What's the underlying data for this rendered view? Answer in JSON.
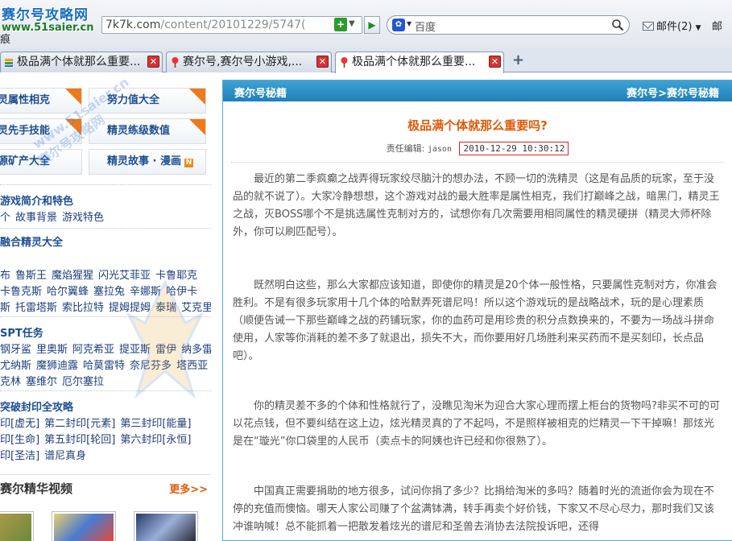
{
  "browser": {
    "logo_line1": "赛尔号攻略网",
    "logo_line2": "www.51saier.cn",
    "address_main": "7k7k.com",
    "address_rest": "/content/20101229/5747(",
    "search_placeholder": "百度",
    "mail_label": "邮件(2)",
    "extra_menu": "邮",
    "trace_label": "痕",
    "new_tab": "+"
  },
  "tabs": [
    {
      "label": "极品满个体就那么重要..."
    },
    {
      "label": "赛尔号,赛尔号小游戏,..."
    },
    {
      "label": "极品满个体就那么重要..."
    }
  ],
  "sidebar": {
    "features": [
      {
        "label": "灵属性相克"
      },
      {
        "label": "努力值大全"
      },
      {
        "label": "灵先手技能"
      },
      {
        "label": "精灵练级数值"
      },
      {
        "label": "源矿产大全"
      },
      {
        "label": "精灵故事 · 漫画",
        "badge": "N"
      }
    ],
    "sections": [
      {
        "title": "游戏简介和特色",
        "rows": [
          [
            "个",
            "故事背景",
            "游戏特色"
          ]
        ]
      },
      {
        "title": "融合精灵大全",
        "rows": [
          [
            "布",
            "鲁斯王",
            "魔焰猩猩",
            "闪光艾菲亚",
            "卡鲁耶克"
          ],
          [
            "卡鲁克斯",
            "哈尔翼蜂",
            "塞拉兔",
            "辛娜斯",
            "哈伊卡"
          ],
          [
            "斯",
            "托雷塔斯",
            "索比拉特",
            "提姆提姆",
            "泰瑞",
            "艾克里桑"
          ]
        ]
      },
      {
        "title": "SPT任务",
        "rows": [
          [
            "钢牙鲨",
            "里奥斯",
            "阿克希亚",
            "提亚斯",
            "雷伊",
            "纳多雷"
          ],
          [
            "尤纳斯",
            "魔狮迪露",
            "哈莫雷特",
            "奈尼芬多",
            "塔西亚"
          ],
          [
            "克林",
            "塞维尔",
            "厄尔塞拉"
          ]
        ]
      },
      {
        "title": "突破封印全攻略",
        "rows": [
          [
            "印[虚无]",
            "第二封印[元素]",
            "第三封印[能量]"
          ],
          [
            "印[生命]",
            "第五封印[轮回]",
            "第六封印[永恒]"
          ],
          [
            "印[圣洁]",
            "谱尼真身"
          ]
        ]
      }
    ],
    "video_title": "赛尔精华视频",
    "video_more": "更多>>",
    "watermark_text": "www.51saier.cn",
    "watermark_text2": "赛尔号攻略网"
  },
  "panel": {
    "header_title": "赛尔号秘籍",
    "breadcrumb": "赛尔号>赛尔号秘籍",
    "article_title": "极品满个体就那么重要吗?",
    "editor_label": "责任编辑:",
    "editor_name": "jason",
    "date": "2010-12-29 10:30:12",
    "paragraphs": [
      "最近的第二季疯癫之战弄得玩家绞尽脑汁的想办法，不顾一切的洗精灵（这是有品质的玩家，至于没品的就不说了）。大家冷静想想，这个游戏对战的最大胜率是属性相克，我们打巅峰之战，暗黑门，精灵王之战，灭BOSS哪个不是挑选属性克制对方的，试想你有几次需要用相同属性的精灵硬拼（精灵大师杯除外，你可以刷匹配号）。",
      "既然明白这些，那么大家都应该知道，即使你的精灵是20个体一般性格，只要属性克制对方，你准会胜利。不是有很多玩家用十几个体的哈默弄死谱尼吗！所以这个游戏玩的是战略战术，玩的是心理素质（顺便告诫一下那些巅峰之战的药铺玩家，你的血药可是用珍贵的积分点数换来的，不要为一场战斗拼命使用，人家等你消耗的差不多了就退出，损失不大，而你要用好几场胜利来买药而不是买刻印，长点品吧）。",
      "你的精灵差不多的个体和性格就行了，没瞧见淘米为迎合大家心理而摆上柜台的货物吗?非买不可的可以花点钱，但不要纠结在这上边，炫光精灵真的了不起吗，不是照样被相克的烂精灵一下干掉嘛！那炫光是在“璇光”你口袋里的人民币（卖点卡的阿姨也许已经和你很熟了）。",
      "中国真正需要捐助的地方很多，试问你捐了多少？比捐给淘米的多吗？随着时光的流逝你会为现在不停的充值而懊恼。哪天人家公司赚了个盆满钵满，转手再卖个好价钱，下家又不尽心尽力，那时我们又该冲谁呐喊！总不能抓着一把散发着炫光的谱尼和圣兽去消协去法院投诉吧，还得"
    ]
  }
}
